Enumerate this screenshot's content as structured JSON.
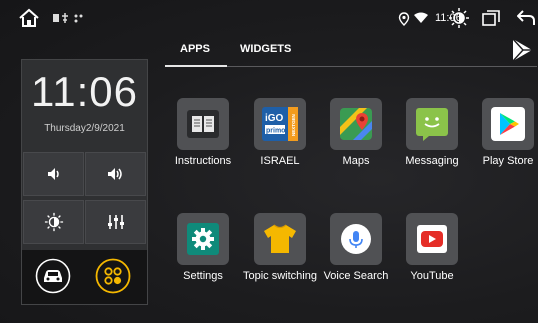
{
  "status_bar": {
    "time": "11:06",
    "icons": [
      "home-icon",
      "usb-icon",
      "bluetooth-icon",
      "location-icon",
      "wifi-icon",
      "brightness-icon",
      "recent-apps-icon",
      "back-icon"
    ]
  },
  "widget_panel": {
    "clock": "11:06",
    "date": "Thursday2/9/2021",
    "tiles": [
      "volume-down-icon",
      "volume-up-icon",
      "brightness-icon",
      "equalizer-icon"
    ],
    "bottom_buttons": [
      "car-icon",
      "apps-icon"
    ]
  },
  "tabs": [
    {
      "label": "APPS",
      "active": true
    },
    {
      "label": "WIDGETS",
      "active": false
    }
  ],
  "apps": [
    {
      "label": "Instructions",
      "icon": "manual-book-icon"
    },
    {
      "label": "ISRAEL",
      "icon": "igo-primo-icon",
      "icon_text_top": "iGO",
      "icon_text_mid": "primo",
      "icon_text_side": "NEXTGEN"
    },
    {
      "label": "Maps",
      "icon": "maps-icon"
    },
    {
      "label": "Messaging",
      "icon": "messaging-icon"
    },
    {
      "label": "Play Store",
      "icon": "play-store-icon"
    },
    {
      "label": "Settings",
      "icon": "settings-gear-icon"
    },
    {
      "label": "Topic switching",
      "icon": "tshirt-icon"
    },
    {
      "label": "Voice Search",
      "icon": "microphone-icon"
    },
    {
      "label": "YouTube",
      "icon": "youtube-icon"
    }
  ],
  "colors": {
    "background": "#1c1c1e",
    "panel": "#2f3032",
    "accent_yellow": "#f5b800",
    "settings_teal": "#0f8a7a",
    "messaging_green": "#8bc34a",
    "youtube_red": "#e52d27"
  }
}
